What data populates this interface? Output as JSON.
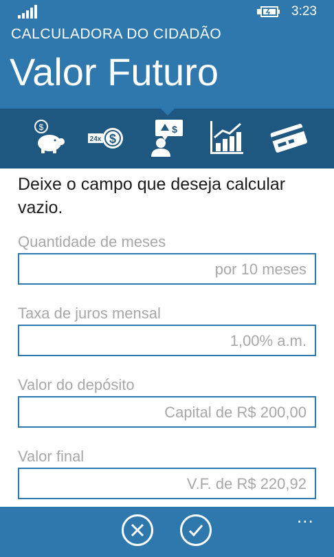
{
  "status_bar": {
    "time": "3:23"
  },
  "header": {
    "app_title": "CALCULADORA DO CIDADÃO",
    "page_title": "Valor Futuro"
  },
  "nav_icons": [
    "piggy-bank-icon",
    "installments-24x-icon",
    "person-presenter-icon",
    "bar-chart-icon",
    "credit-card-icon"
  ],
  "content": {
    "instructions": "Deixe o campo que deseja calcular vazio.",
    "fields": [
      {
        "label": "Quantidade de meses",
        "value": "por 10 meses"
      },
      {
        "label": "Taxa de juros mensal",
        "value": "1,00% a.m."
      },
      {
        "label": "Valor do depósito",
        "value": "Capital de R$ 200,00"
      },
      {
        "label": "Valor final",
        "value": "V.F. de R$ 220,92"
      }
    ]
  },
  "app_bar": {
    "buttons": [
      "cancel-icon",
      "confirm-icon"
    ],
    "more": "..."
  },
  "colors": {
    "header": "#2e78ad",
    "nav": "#1e5780",
    "field_border": "#2e78ad",
    "label_text": "#a7a7a7"
  }
}
